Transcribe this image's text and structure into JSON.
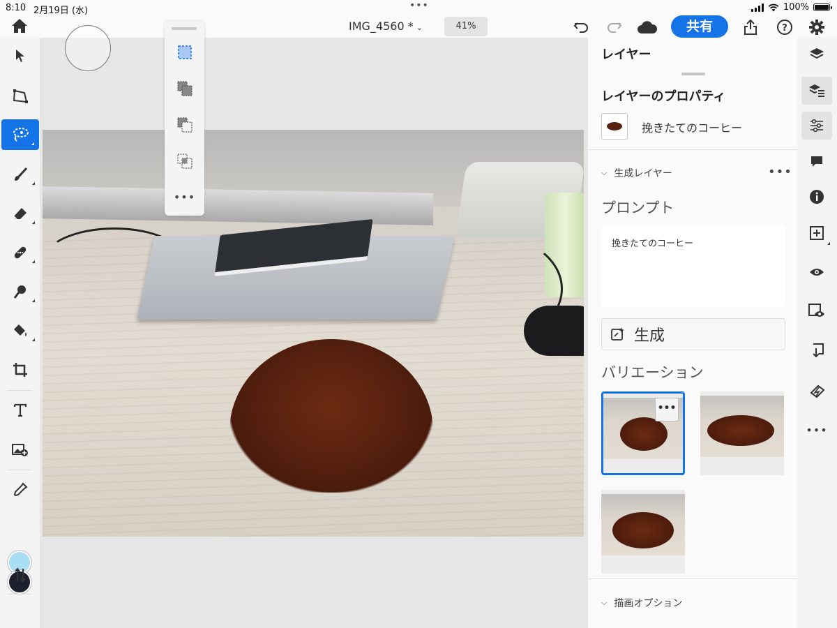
{
  "status_bar": {
    "time": "8:10",
    "date": "2月19日 (水)",
    "battery": "100%"
  },
  "app_bar": {
    "doc_title": "IMG_4560 *",
    "zoom": "41%",
    "share_label": "共有"
  },
  "layers_panel": {
    "header": "レイヤー",
    "props_title": "レイヤーのプロパティ",
    "layer_name": "挽きたてのコーヒー",
    "gen_layer_section": "生成レイヤー",
    "prompt_label": "プロンプト",
    "prompt_text": "挽きたてのコーヒー",
    "generate_label": "生成",
    "variations_label": "バリエーション",
    "draw_options_section": "描画オプション"
  },
  "colors": {
    "accent": "#1473e6",
    "foreground_swatch": "#a9def5",
    "background_swatch": "#1e2030"
  },
  "left_tools": [
    "select-icon",
    "transform-icon",
    "lasso-icon",
    "brush-icon",
    "eraser-icon",
    "healing-icon",
    "dodge-burn-icon",
    "paint-bucket-icon",
    "crop-icon",
    "text-icon",
    "place-image-icon",
    "eyedropper-icon",
    "swap-colors-icon"
  ],
  "right_tools": [
    "layers-icon",
    "layer-props-icon",
    "adjustments-icon",
    "comments-icon",
    "info-icon",
    "add-layer-icon",
    "visibility-icon",
    "mask-visibility-icon",
    "merge-down-icon",
    "clear-icon",
    "more-icon"
  ]
}
